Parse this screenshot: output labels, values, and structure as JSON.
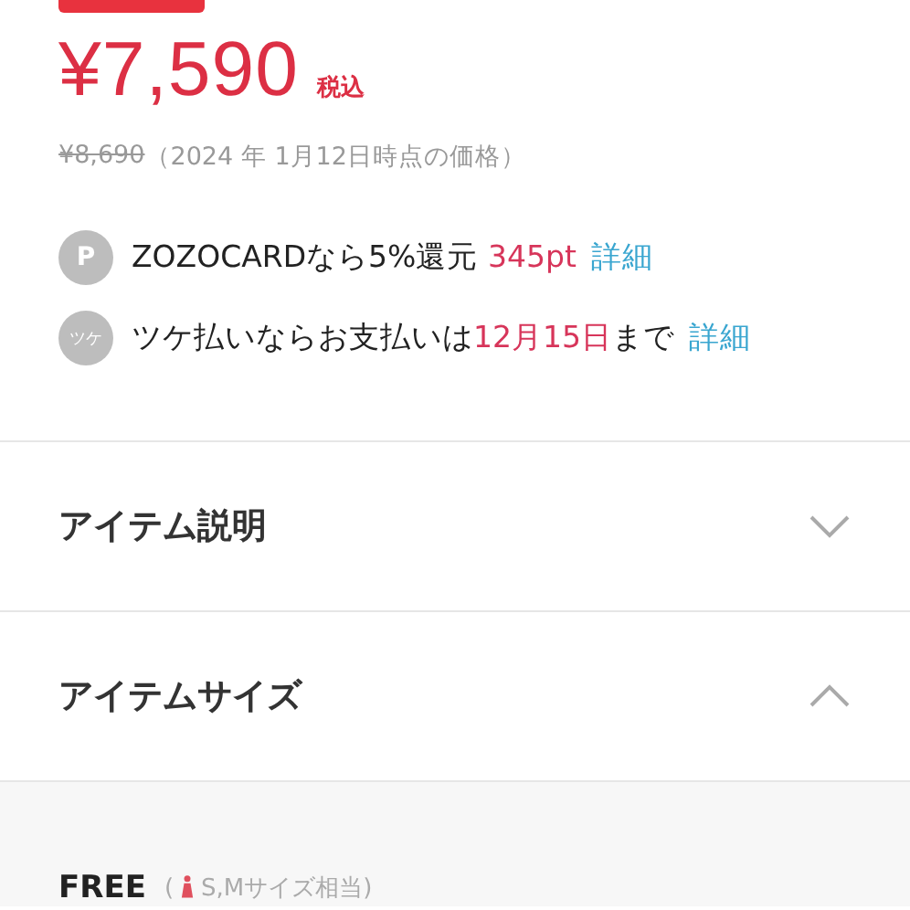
{
  "price": {
    "amount": "¥7,590",
    "tax_label": "税込",
    "original": "¥8,690",
    "original_note": "（2024 年 1月12日時点の価格）"
  },
  "benefits": [
    {
      "icon": "P",
      "parts": [
        {
          "text": "ZOZOCARDなら5%還元 ",
          "emphasis": false
        },
        {
          "text": "345pt",
          "emphasis": true
        }
      ],
      "link": "詳細"
    },
    {
      "icon": "ツケ",
      "parts": [
        {
          "text": "ツケ払いならお支払いは",
          "emphasis": false
        },
        {
          "text": "12月15日",
          "emphasis": true
        },
        {
          "text": "まで",
          "emphasis": false
        }
      ],
      "link": "詳細"
    }
  ],
  "sections": [
    {
      "title": "アイテム説明",
      "expanded": false
    },
    {
      "title": "アイテムサイズ",
      "expanded": true
    }
  ],
  "size": {
    "name": "FREE",
    "note_open": "(",
    "note": "S,Mサイズ相当)"
  }
}
